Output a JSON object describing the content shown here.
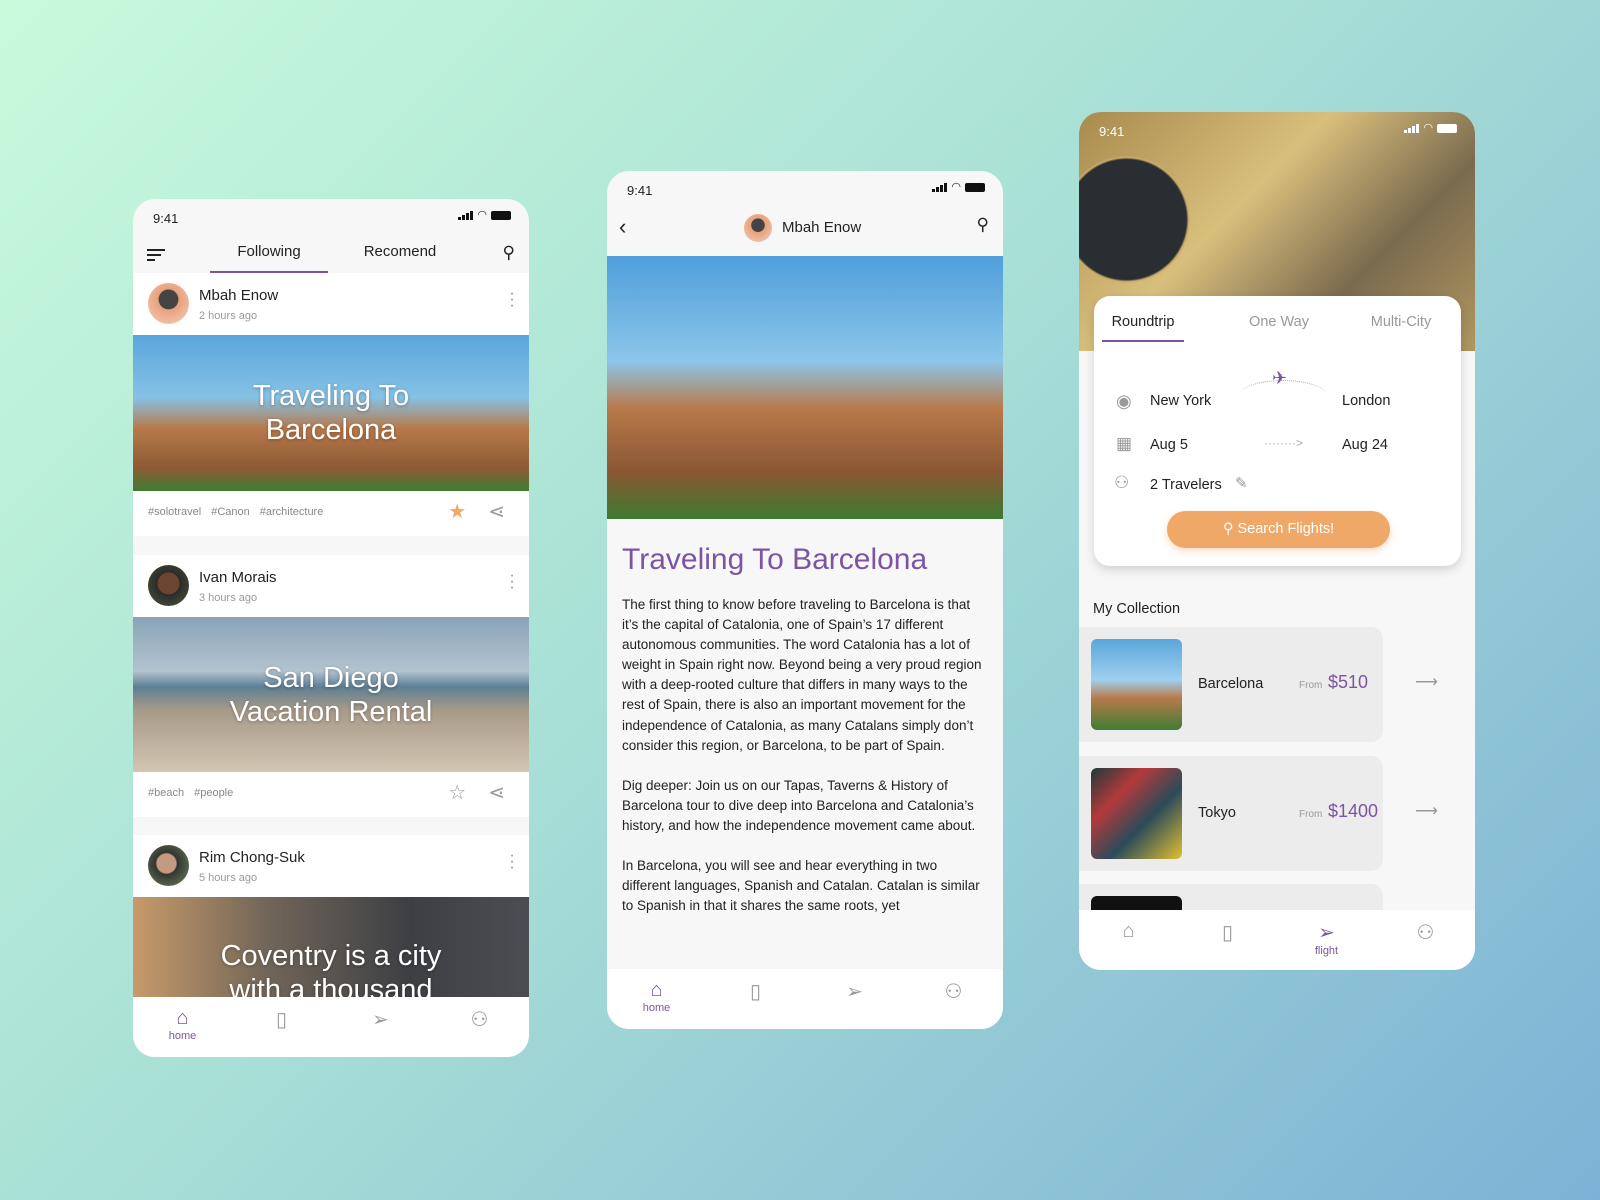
{
  "status": {
    "time": "9:41"
  },
  "feed": {
    "tabs": [
      {
        "label": "Following",
        "active": true
      },
      {
        "label": "Recomend",
        "active": false
      }
    ],
    "posts": [
      {
        "author": "Mbah Enow",
        "time": "2 hours ago",
        "title": "Traveling To Barcelona",
        "tags": [
          "#solotravel",
          "#Canon",
          "#architecture"
        ],
        "starred": true
      },
      {
        "author": "Ivan Morais",
        "time": "3 hours ago",
        "title": "San Diego Vacation Rental",
        "tags": [
          "#beach",
          "#people"
        ],
        "starred": false
      },
      {
        "author": "Rim Chong-Suk",
        "time": "5 hours ago",
        "title": "Coventry is a city with a thousand",
        "tags": [],
        "starred": false
      }
    ]
  },
  "article": {
    "author": "Mbah Enow",
    "title": "Traveling To Barcelona",
    "paragraphs": [
      "The first thing to know before traveling to Barcelona is that it’s the capital of Catalonia, one of Spain’s 17 different autonomous communities. The word Catalonia has a lot of weight in Spain right now. Beyond being a very proud region with a deep-rooted culture that differs in many ways to the rest of Spain, there is also an important movement for the independence of Catalonia, as many Catalans simply don’t consider this region, or Barcelona, to be part of Spain.",
      "Dig deeper: Join us on our Tapas, Taverns & History of Barcelona tour to dive deep into Barcelona and Catalonia’s history, and how the independence movement came about.",
      "In Barcelona, you will see and hear everything in two different languages, Spanish and Catalan. Catalan is similar to Spanish in that it shares the same roots, yet"
    ]
  },
  "flights": {
    "tabs": [
      {
        "label": "Roundtrip",
        "active": true
      },
      {
        "label": "One Way",
        "active": false
      },
      {
        "label": "Multi-City",
        "active": false
      }
    ],
    "from": "New York",
    "to": "London",
    "depart": "Aug 5",
    "return": "Aug 24",
    "travelers": "2 Travelers",
    "search_label": "Search Flights!",
    "collection_title": "My Collection",
    "collection": [
      {
        "name": "Barcelona",
        "from_label": "From",
        "price": "$510"
      },
      {
        "name": "Tokyo",
        "from_label": "From",
        "price": "$1400"
      }
    ]
  },
  "nav": {
    "home": "home",
    "flight": "flight"
  },
  "colors": {
    "accent": "#7b55a3",
    "button": "#f0a868"
  }
}
